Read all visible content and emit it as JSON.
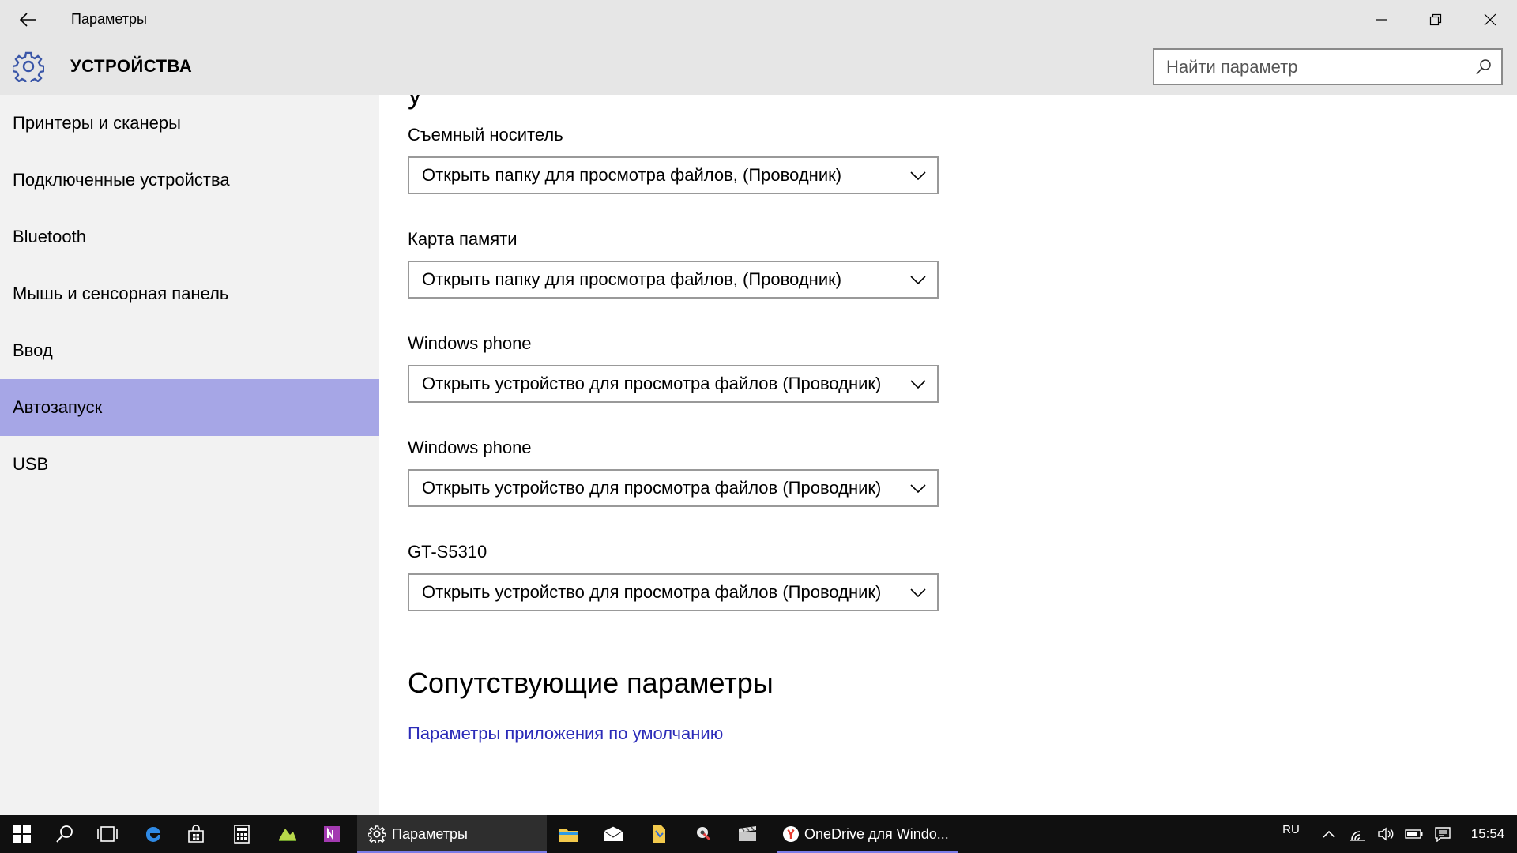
{
  "window": {
    "title": "Параметры",
    "minimize_icon": "minimize-icon",
    "restore_icon": "restore-icon",
    "close_icon": "close-icon"
  },
  "header": {
    "section_title": "УСТРОЙСТВА",
    "search_placeholder": "Найти параметр"
  },
  "sidebar": {
    "items": [
      {
        "label": "Принтеры и сканеры"
      },
      {
        "label": "Подключенные устройства"
      },
      {
        "label": "Bluetooth"
      },
      {
        "label": "Мышь и сенсорная панель"
      },
      {
        "label": "Ввод"
      },
      {
        "label": "Автозапуск",
        "selected": true
      },
      {
        "label": "USB"
      }
    ]
  },
  "main": {
    "fields": [
      {
        "label": "Съемный носитель",
        "value": "Открыть папку для просмотра файлов, (Проводник)"
      },
      {
        "label": "Карта памяти",
        "value": "Открыть папку для просмотра файлов, (Проводник)"
      },
      {
        "label": "Windows phone",
        "value": "Открыть устройство для просмотра файлов (Проводник)"
      },
      {
        "label": "Windows phone",
        "value": "Открыть устройство для просмотра файлов (Проводник)"
      },
      {
        "label": "GT-S5310",
        "value": "Открыть устройство для просмотра файлов (Проводник)"
      }
    ],
    "related_heading": "Сопутствующие параметры",
    "related_link": "Параметры приложения по умолчанию"
  },
  "taskbar": {
    "apps": [
      {
        "label": "Параметры",
        "active": true
      },
      {
        "label": "OneDrive для Windo..."
      }
    ],
    "language": "RU",
    "time": "15:54"
  },
  "colors": {
    "chrome": "#e6e6e6",
    "sidebar": "#f2f2f2",
    "selected": "#a6a6e6",
    "link": "#2b2bb8",
    "taskbar": "#101010",
    "accent": "#7c7ce8",
    "gear": "#3a56a8"
  }
}
